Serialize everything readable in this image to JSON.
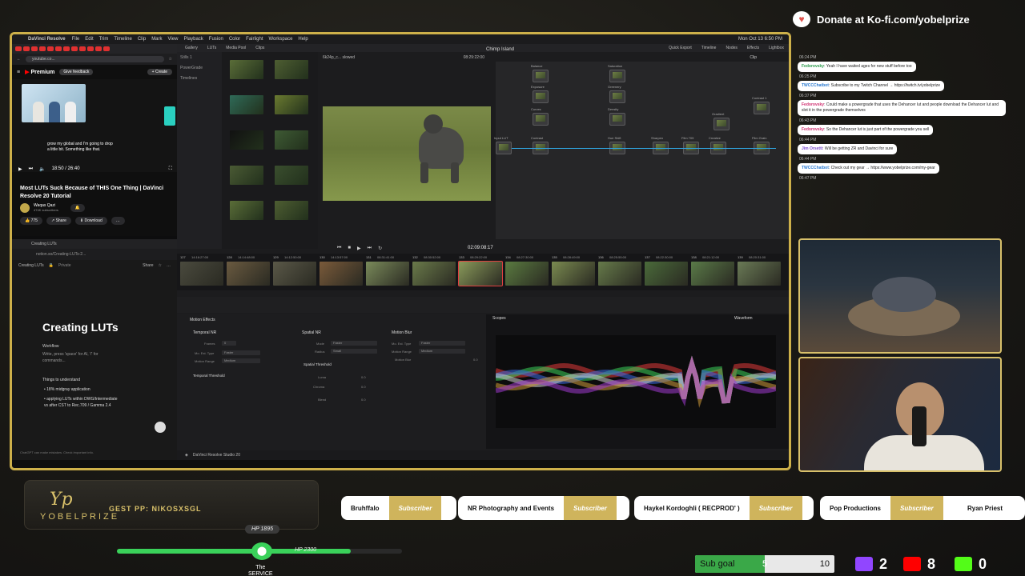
{
  "mac": {
    "app": "DaVinci Resolve",
    "menus": [
      "File",
      "Edit",
      "Trim",
      "Timeline",
      "Clip",
      "Mark",
      "View",
      "Playback",
      "Fusion",
      "Color",
      "Fairlight",
      "Workspace",
      "Help"
    ],
    "clock": "Mon Oct 13  6:50 PM"
  },
  "browser": {
    "url": "youtube.co...",
    "yt_logo": "Premium",
    "feedback": "Give feedback",
    "create": "Create",
    "video_subtitle": "grow my global and I'm going to drop\na little bit. Something like that.",
    "video_time": "18:50 / 26:40",
    "video_title": "Most LUTs Suck Because of THIS One Thing | DaVinci Resolve 20 Tutorial",
    "channel": "Waqas Qazi",
    "subscribers": "474K subscribers",
    "likes": "775",
    "share": "Share",
    "download": "Download"
  },
  "notion": {
    "tab": "Creating LUTs",
    "url": "notion.so/Creating-LUTs-2...",
    "breadcrumb": "Creating LUTs",
    "privacy": "Private",
    "share": "Share",
    "title": "Creating LUTs",
    "workflow": "Workflow",
    "prompt": "Write, press 'space' for AI, '/' for\ncommands...",
    "section": "Things to understand",
    "bullets": [
      "18% midgray application",
      "applying LUTs within DWG/Intermediate\nvs after CST to Rec.709 / Gamma 2.4"
    ],
    "footer": "ChatGPT can make mistakes. Check important info."
  },
  "resolve": {
    "pages": [
      "Gallery",
      "LUTs",
      "Media Pool",
      "Clips"
    ],
    "sidebar": [
      "Stills 1",
      "PowerGrade",
      "Timelines"
    ],
    "viewer_format": "6k24p_c... slowed",
    "viewer_tc_top": "08:29:22:00",
    "clip_name": "Chimp Island",
    "right_tabs": [
      "Quick Export",
      "Timeline",
      "Nodes",
      "Effects",
      "Lightbox"
    ],
    "node_mode": "Clip",
    "nodes": [
      {
        "label": "Balance",
        "n": "02"
      },
      {
        "label": "Exposure",
        "n": "03"
      },
      {
        "label": "Curves",
        "n": "07"
      },
      {
        "label": "Contrast",
        "n": "04"
      },
      {
        "label": "Saturation",
        "n": "08"
      },
      {
        "label": "Greenery",
        "n": "09"
      },
      {
        "label": "Density",
        "n": "10"
      },
      {
        "label": "Hue Shift",
        "n": "11"
      },
      {
        "label": "Sharpen",
        "n": "12"
      },
      {
        "label": "Film 709",
        "n": "13"
      },
      {
        "label": "Creative",
        "n": "14"
      },
      {
        "label": "Gradient",
        "n": "15"
      },
      {
        "label": "Contrast 1",
        "n": "16"
      },
      {
        "label": "Film Grain",
        "n": "17"
      },
      {
        "label": "Input LUT",
        "n": "01"
      }
    ],
    "timecode": "02:09:08:17",
    "clips": [
      {
        "n": "127",
        "tc": "14:16:27:00"
      },
      {
        "n": "128",
        "tc": "14:14:48:00"
      },
      {
        "n": "129",
        "tc": "14:12:50:00"
      },
      {
        "n": "130",
        "tc": "14:13:57:00"
      },
      {
        "n": "131",
        "tc": "08:31:41:00"
      },
      {
        "n": "132",
        "tc": "08:30:52:00"
      },
      {
        "n": "133",
        "tc": "08:29:22:00"
      },
      {
        "n": "134",
        "tc": "08:27:30:00"
      },
      {
        "n": "135",
        "tc": "08:28:49:00"
      },
      {
        "n": "136",
        "tc": "08:25:55:00"
      },
      {
        "n": "137",
        "tc": "08:22:30:00"
      },
      {
        "n": "138",
        "tc": "08:21:12:00"
      },
      {
        "n": "139",
        "tc": "08:20:31:00"
      }
    ],
    "motion_title": "Motion Effects",
    "temporal_nr": "Temporal NR",
    "spatial_nr": "Spatial NR",
    "motion_blur": "Motion Blur",
    "frames_label": "Frames",
    "frames_val": "0",
    "mo_est_label": "Mo. Est. Type",
    "mo_est_val": "Faster",
    "motion_range_label": "Motion Range",
    "motion_range_val": "Medium",
    "mode_label": "Mode",
    "mode_val": "Faster",
    "radius_label": "Radius",
    "radius_val": "Small",
    "mb_est_label": "Mo. Est. Type",
    "mb_est_val": "Faster",
    "mb_range_label": "Motion Range",
    "mb_range_val": "Medium",
    "mb_blur_label": "Motion Blur",
    "mb_blur_val": "0.0",
    "temporal_threshold": "Temporal Threshold",
    "spatial_threshold": "Spatial Threshold",
    "luma": "Luma",
    "chroma": "Chroma",
    "blend": "Blend",
    "thresh_val": "0.0",
    "scopes": "Scopes",
    "waveform": "Waveform",
    "footer": "DaVinci Resolve Studio 20"
  },
  "right": {
    "kofi": "Donate at Ko-fi.com/yobelprize",
    "chat": [
      {
        "time": "06:24 PM"
      },
      {
        "user": "Fedorovsky",
        "color": "#2a9a4a",
        "text": "Yeah I have waited ages for new stuff before too"
      },
      {
        "time": "06:25 PM"
      },
      {
        "user": "TWCCChatbot",
        "color": "#2a7ad0",
        "text": "Subscribe to my Twitch Channel → https://twitch.tv/yobelprize"
      },
      {
        "time": "06:37 PM"
      },
      {
        "user": "Fedorovsky",
        "color": "#d03070",
        "text": "Could make a powergrade that uses the Dehancer lut and people download the Dehancer lut and slot it in the powergrade themselves"
      },
      {
        "time": "06:43 PM"
      },
      {
        "user": "Fedorovsky",
        "color": "#d03070",
        "text": "So the Dehancer lut is just part of the powergrade you sell"
      },
      {
        "time": "06:44 PM"
      },
      {
        "user": "Jim Orsetti",
        "color": "#7a4ad0",
        "text": "Will be getting ZR and Davinci for sure"
      },
      {
        "time": "06:44 PM"
      },
      {
        "user": "TWCCChatbot",
        "color": "#2a7ad0",
        "text": "Check out my gear → https://www.yobelprize.com/my-gear"
      },
      {
        "time": "06:47 PM"
      }
    ]
  },
  "bottom": {
    "logo_text": "YOBELPRIZE",
    "logo_mark": "Yp",
    "guest": "GEST PP: NIKOSXSGL",
    "subscribers": [
      {
        "name": "Bruhffalo",
        "tag": "Subscriber"
      },
      {
        "name": "NR Photography and Events",
        "tag": "Subscriber"
      },
      {
        "name": "Haykel Kordoghli ( RECPROD' )",
        "tag": "Subscriber"
      },
      {
        "name": "Pop Productions",
        "tag": "Subscriber"
      },
      {
        "name": "Ryan Priest",
        "tag": ""
      }
    ],
    "hp_top": "HP 1895",
    "hp_right": "HP 2300",
    "hp_fraction": 0.82,
    "hp_name": "The\nSERVICE",
    "sub_goal_label": "Sub goal",
    "sub_goal_current": "5",
    "sub_goal_target": "10",
    "sub_goal_fraction": 0.5,
    "twitch_count": "2",
    "youtube_count": "8",
    "kick_count": "0"
  },
  "colors": {
    "accent_gold": "#d8c06a",
    "hp_green": "#3ad15a",
    "twitch": "#9146ff",
    "youtube": "#ff0000",
    "kick": "#53fc18"
  }
}
